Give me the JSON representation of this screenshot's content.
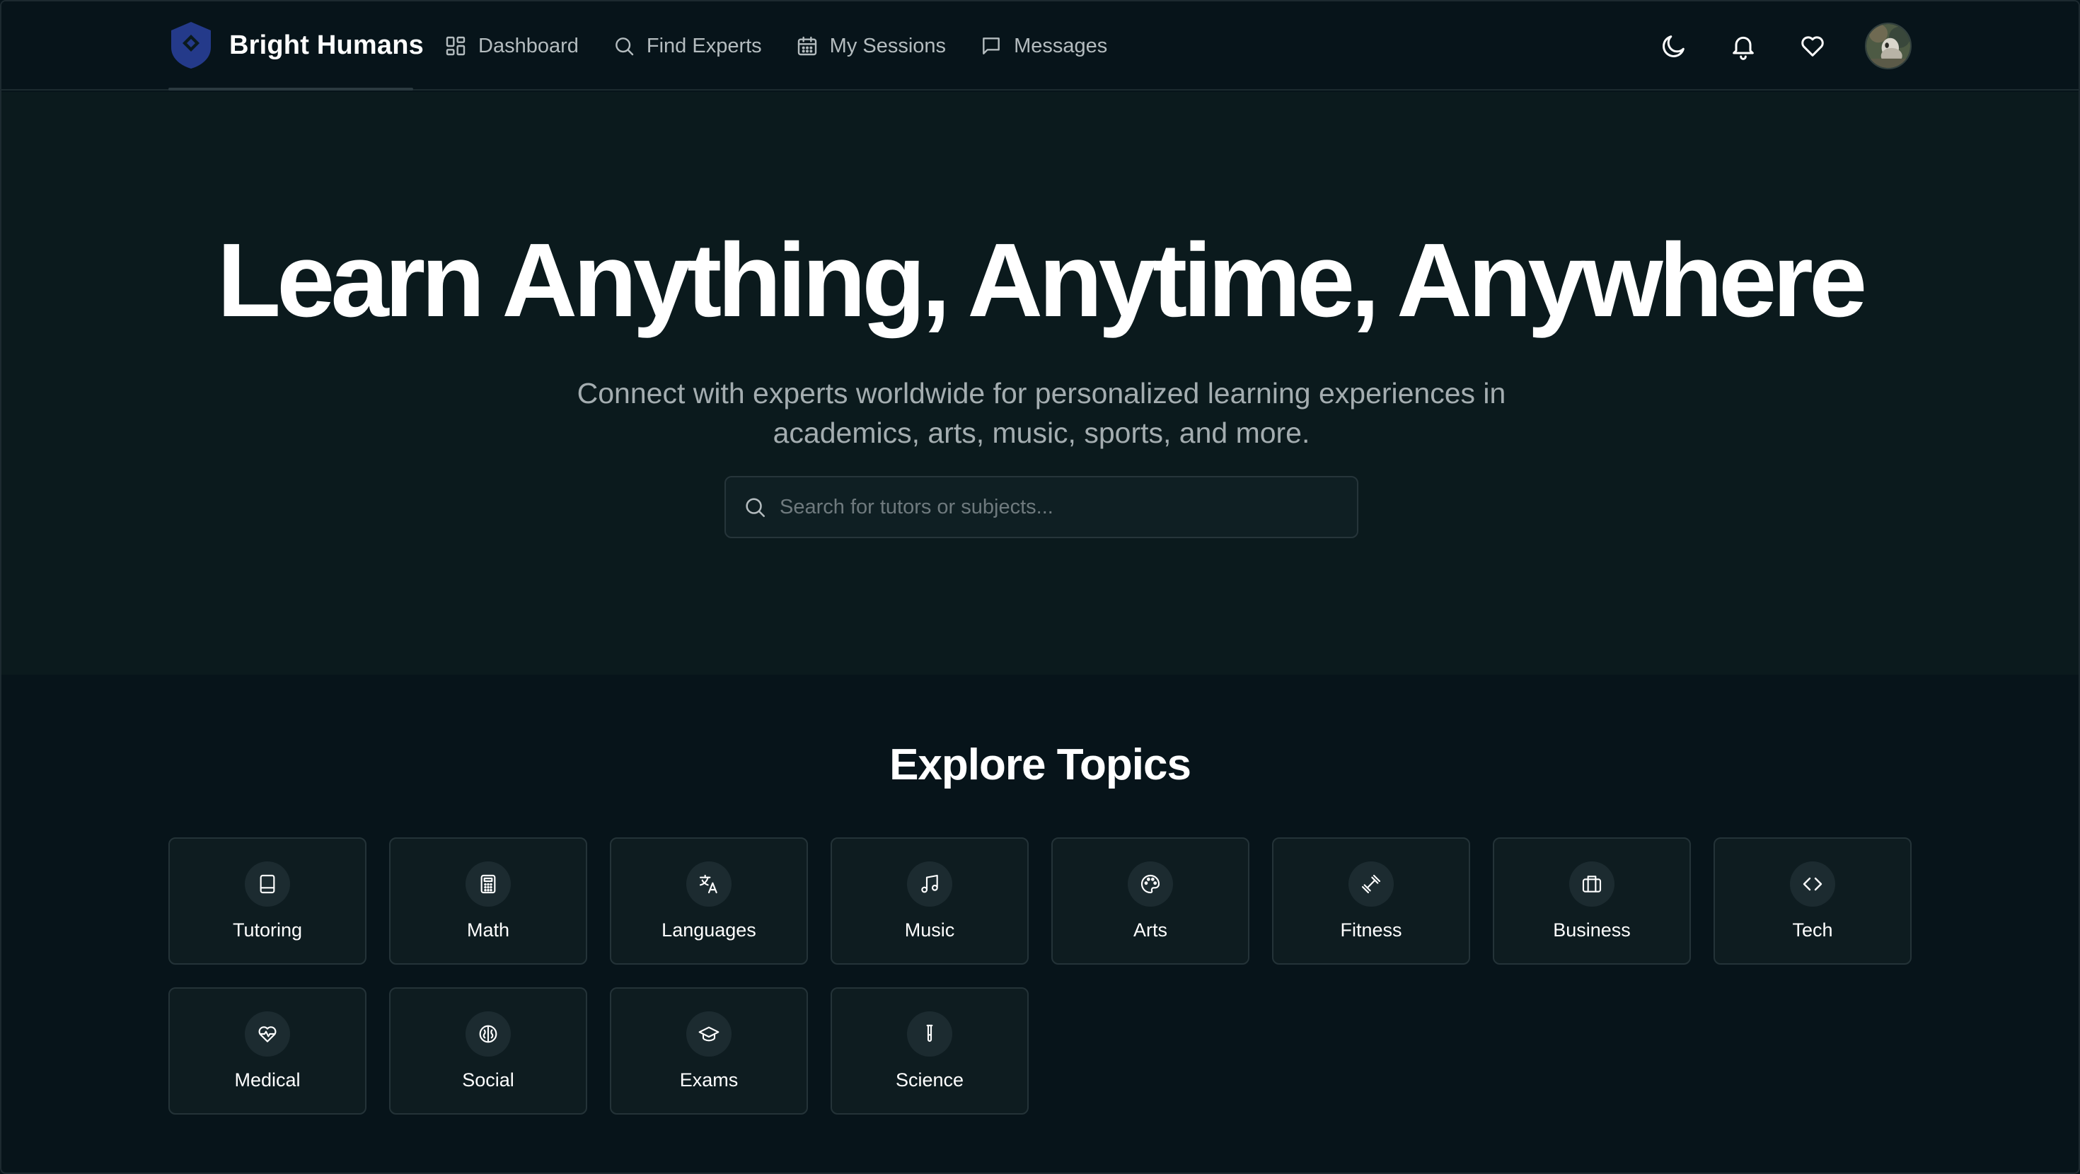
{
  "brand": {
    "name": "Bright Humans",
    "logo_icon": "shield-logo-icon",
    "logo_color": "#243a8a"
  },
  "nav": {
    "links": [
      {
        "label": "Dashboard",
        "icon": "dashboard-icon"
      },
      {
        "label": "Find Experts",
        "icon": "search-icon"
      },
      {
        "label": "My Sessions",
        "icon": "calendar-icon"
      },
      {
        "label": "Messages",
        "icon": "message-icon"
      }
    ],
    "actions": [
      {
        "icon": "moon-icon"
      },
      {
        "icon": "bell-icon"
      },
      {
        "icon": "heart-icon"
      }
    ],
    "avatar_icon": "user-avatar"
  },
  "hero": {
    "title": "Learn Anything, Anytime, Anywhere",
    "subtitle": "Connect with experts worldwide for personalized learning experiences in academics, arts, music, sports, and more.",
    "search_placeholder": "Search for tutors or subjects...",
    "search_value": ""
  },
  "topics": {
    "title": "Explore Topics",
    "items": [
      {
        "label": "Tutoring",
        "icon": "book-icon"
      },
      {
        "label": "Math",
        "icon": "calculator-icon"
      },
      {
        "label": "Languages",
        "icon": "translate-icon"
      },
      {
        "label": "Music",
        "icon": "music-note-icon"
      },
      {
        "label": "Arts",
        "icon": "palette-icon"
      },
      {
        "label": "Fitness",
        "icon": "dumbbell-icon"
      },
      {
        "label": "Business",
        "icon": "briefcase-icon"
      },
      {
        "label": "Tech",
        "icon": "code-icon"
      },
      {
        "label": "Medical",
        "icon": "heart-pulse-icon"
      },
      {
        "label": "Social",
        "icon": "brain-icon"
      },
      {
        "label": "Exams",
        "icon": "graduation-cap-icon"
      },
      {
        "label": "Science",
        "icon": "test-tube-icon"
      }
    ]
  },
  "colors": {
    "background": "#07141a",
    "hero_background": "#0b1a1d",
    "card_background": "#0e1c20",
    "text_primary": "#ffffff",
    "text_muted": "#a4adb0",
    "accent": "#243a8a"
  }
}
